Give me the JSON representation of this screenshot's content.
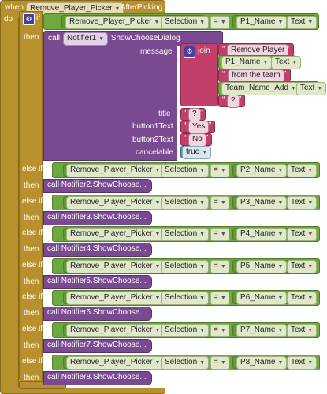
{
  "event": {
    "when": "when",
    "component": "Remove_Player_Picker",
    "event_name": ".AfterPicking",
    "do": "do"
  },
  "if_block": {
    "if": "if",
    "then": "then",
    "else_if": "else if"
  },
  "first": {
    "condition": {
      "component": "Remove_Player_Picker",
      "property": "Selection",
      "op": "=",
      "right_component": "P1_Name",
      "right_property": "Text"
    },
    "call": {
      "call": "call",
      "component": "Notifier1",
      "method": ".ShowChooseDialog"
    },
    "params": {
      "message": "message",
      "title": "title",
      "button1Text": "button1Text",
      "button2Text": "button2Text",
      "cancelable": "cancelable"
    },
    "join": {
      "label": "join",
      "items": [
        "Remove Player",
        "from the team",
        "?"
      ],
      "item_components": [
        {
          "component": "P1_Name",
          "property": "Text"
        },
        {
          "component": "Team_Name_Add",
          "property": "Text"
        }
      ]
    },
    "title_value": "?",
    "button1_value": "Yes",
    "button2_value": "No",
    "cancelable_value": "true"
  },
  "branches": [
    {
      "right_component": "P2_Name",
      "notifier": "Notifier2",
      "method": ".ShowChoose..."
    },
    {
      "right_component": "P3_Name",
      "notifier": "Notifier3",
      "method": ".ShowChoose..."
    },
    {
      "right_component": "P4_Name",
      "notifier": "Notifier4",
      "method": ".ShowChoose..."
    },
    {
      "right_component": "P5_Name",
      "notifier": "Notifier5",
      "method": ".ShowChoose..."
    },
    {
      "right_component": "P6_Name",
      "notifier": "Notifier6",
      "method": ".ShowChoose..."
    },
    {
      "right_component": "P7_Name",
      "notifier": "Notifier7",
      "method": ".ShowChoose..."
    },
    {
      "right_component": "P8_Name",
      "notifier": "Notifier8",
      "method": ".ShowChoose..."
    }
  ],
  "common": {
    "left_component": "Remove_Player_Picker",
    "property": "Selection",
    "op": "=",
    "right_property": "Text"
  },
  "colors": {
    "event": "#b8912f",
    "procedure": "#7a4a90",
    "component": "#6fa83f",
    "text": "#c23f6a",
    "control": "#b8912f"
  }
}
